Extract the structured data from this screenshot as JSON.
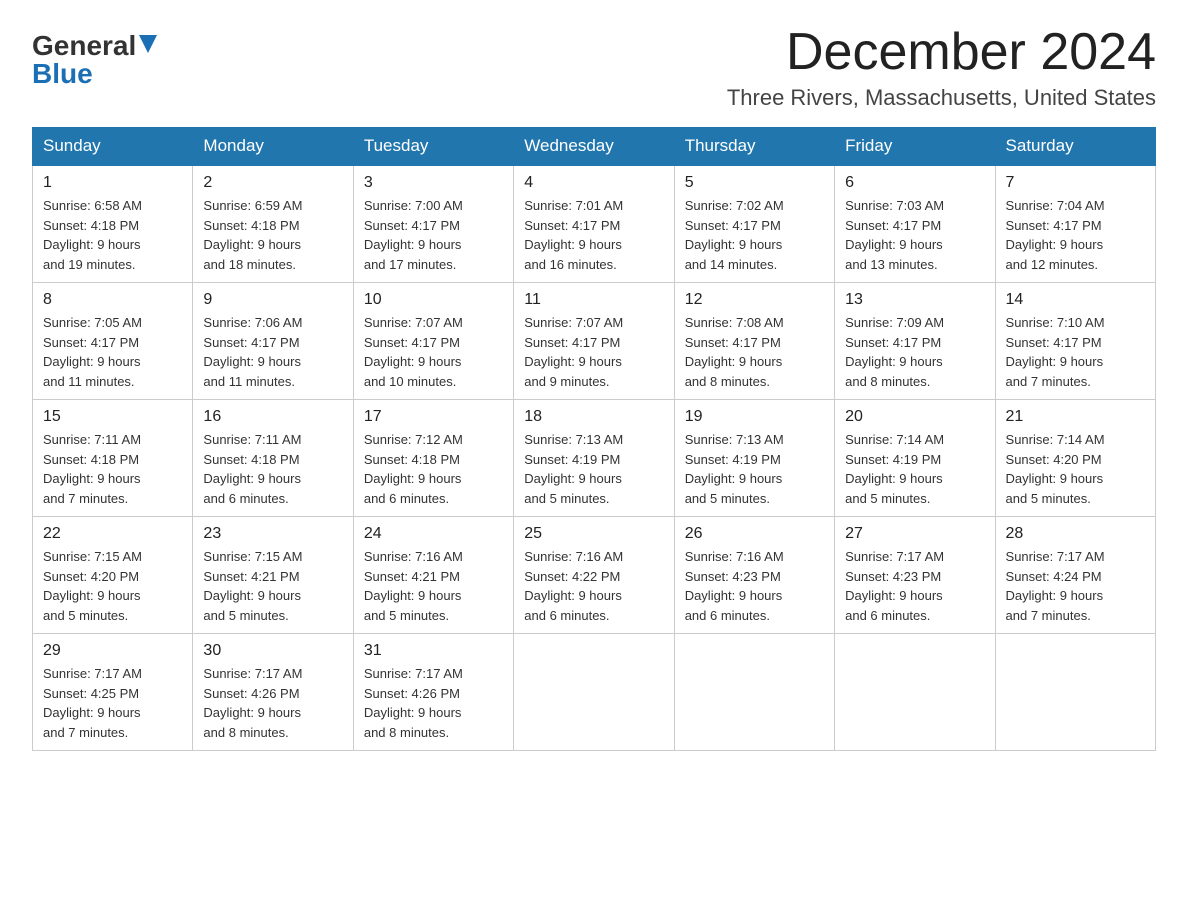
{
  "logo": {
    "general": "General",
    "blue": "Blue"
  },
  "title": "December 2024",
  "subtitle": "Three Rivers, Massachusetts, United States",
  "days": [
    "Sunday",
    "Monday",
    "Tuesday",
    "Wednesday",
    "Thursday",
    "Friday",
    "Saturday"
  ],
  "weeks": [
    [
      {
        "date": "1",
        "sunrise": "6:58 AM",
        "sunset": "4:18 PM",
        "daylight": "9 hours and 19 minutes."
      },
      {
        "date": "2",
        "sunrise": "6:59 AM",
        "sunset": "4:18 PM",
        "daylight": "9 hours and 18 minutes."
      },
      {
        "date": "3",
        "sunrise": "7:00 AM",
        "sunset": "4:17 PM",
        "daylight": "9 hours and 17 minutes."
      },
      {
        "date": "4",
        "sunrise": "7:01 AM",
        "sunset": "4:17 PM",
        "daylight": "9 hours and 16 minutes."
      },
      {
        "date": "5",
        "sunrise": "7:02 AM",
        "sunset": "4:17 PM",
        "daylight": "9 hours and 14 minutes."
      },
      {
        "date": "6",
        "sunrise": "7:03 AM",
        "sunset": "4:17 PM",
        "daylight": "9 hours and 13 minutes."
      },
      {
        "date": "7",
        "sunrise": "7:04 AM",
        "sunset": "4:17 PM",
        "daylight": "9 hours and 12 minutes."
      }
    ],
    [
      {
        "date": "8",
        "sunrise": "7:05 AM",
        "sunset": "4:17 PM",
        "daylight": "9 hours and 11 minutes."
      },
      {
        "date": "9",
        "sunrise": "7:06 AM",
        "sunset": "4:17 PM",
        "daylight": "9 hours and 11 minutes."
      },
      {
        "date": "10",
        "sunrise": "7:07 AM",
        "sunset": "4:17 PM",
        "daylight": "9 hours and 10 minutes."
      },
      {
        "date": "11",
        "sunrise": "7:07 AM",
        "sunset": "4:17 PM",
        "daylight": "9 hours and 9 minutes."
      },
      {
        "date": "12",
        "sunrise": "7:08 AM",
        "sunset": "4:17 PM",
        "daylight": "9 hours and 8 minutes."
      },
      {
        "date": "13",
        "sunrise": "7:09 AM",
        "sunset": "4:17 PM",
        "daylight": "9 hours and 8 minutes."
      },
      {
        "date": "14",
        "sunrise": "7:10 AM",
        "sunset": "4:17 PM",
        "daylight": "9 hours and 7 minutes."
      }
    ],
    [
      {
        "date": "15",
        "sunrise": "7:11 AM",
        "sunset": "4:18 PM",
        "daylight": "9 hours and 7 minutes."
      },
      {
        "date": "16",
        "sunrise": "7:11 AM",
        "sunset": "4:18 PM",
        "daylight": "9 hours and 6 minutes."
      },
      {
        "date": "17",
        "sunrise": "7:12 AM",
        "sunset": "4:18 PM",
        "daylight": "9 hours and 6 minutes."
      },
      {
        "date": "18",
        "sunrise": "7:13 AM",
        "sunset": "4:19 PM",
        "daylight": "9 hours and 5 minutes."
      },
      {
        "date": "19",
        "sunrise": "7:13 AM",
        "sunset": "4:19 PM",
        "daylight": "9 hours and 5 minutes."
      },
      {
        "date": "20",
        "sunrise": "7:14 AM",
        "sunset": "4:19 PM",
        "daylight": "9 hours and 5 minutes."
      },
      {
        "date": "21",
        "sunrise": "7:14 AM",
        "sunset": "4:20 PM",
        "daylight": "9 hours and 5 minutes."
      }
    ],
    [
      {
        "date": "22",
        "sunrise": "7:15 AM",
        "sunset": "4:20 PM",
        "daylight": "9 hours and 5 minutes."
      },
      {
        "date": "23",
        "sunrise": "7:15 AM",
        "sunset": "4:21 PM",
        "daylight": "9 hours and 5 minutes."
      },
      {
        "date": "24",
        "sunrise": "7:16 AM",
        "sunset": "4:21 PM",
        "daylight": "9 hours and 5 minutes."
      },
      {
        "date": "25",
        "sunrise": "7:16 AM",
        "sunset": "4:22 PM",
        "daylight": "9 hours and 6 minutes."
      },
      {
        "date": "26",
        "sunrise": "7:16 AM",
        "sunset": "4:23 PM",
        "daylight": "9 hours and 6 minutes."
      },
      {
        "date": "27",
        "sunrise": "7:17 AM",
        "sunset": "4:23 PM",
        "daylight": "9 hours and 6 minutes."
      },
      {
        "date": "28",
        "sunrise": "7:17 AM",
        "sunset": "4:24 PM",
        "daylight": "9 hours and 7 minutes."
      }
    ],
    [
      {
        "date": "29",
        "sunrise": "7:17 AM",
        "sunset": "4:25 PM",
        "daylight": "9 hours and 7 minutes."
      },
      {
        "date": "30",
        "sunrise": "7:17 AM",
        "sunset": "4:26 PM",
        "daylight": "9 hours and 8 minutes."
      },
      {
        "date": "31",
        "sunrise": "7:17 AM",
        "sunset": "4:26 PM",
        "daylight": "9 hours and 8 minutes."
      },
      null,
      null,
      null,
      null
    ]
  ],
  "labels": {
    "sunrise": "Sunrise:",
    "sunset": "Sunset:",
    "daylight": "Daylight:"
  }
}
